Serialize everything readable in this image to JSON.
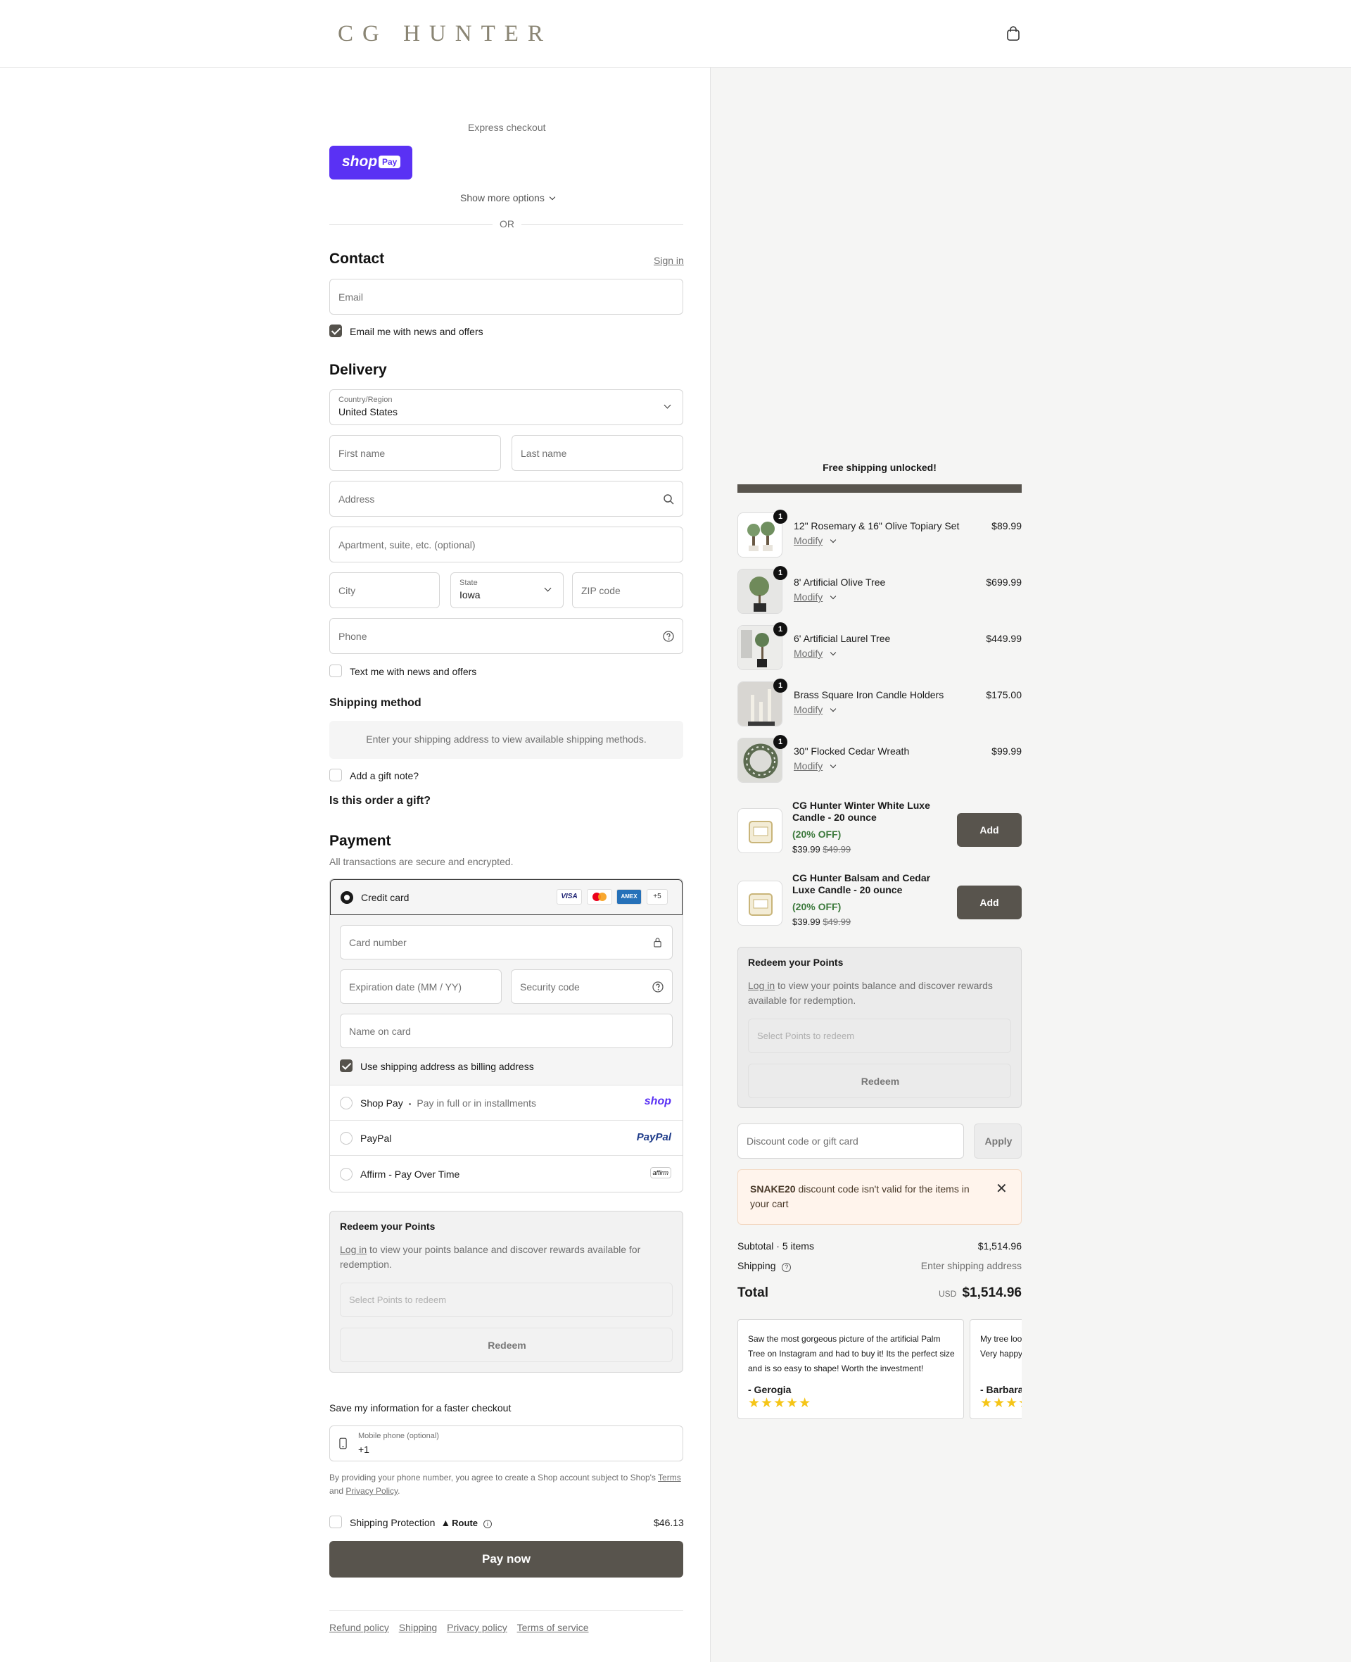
{
  "brand": {
    "logo_text": "CG HUNTER"
  },
  "express": {
    "title": "Express checkout",
    "shop_pay_label": "shop",
    "shop_pay_badge": "Pay",
    "show_more": "Show more options",
    "or": "OR"
  },
  "contact": {
    "title": "Contact",
    "sign_in": "Sign in",
    "email_placeholder": "Email",
    "email_news_label": "Email me with news and offers",
    "email_news_checked": true
  },
  "delivery": {
    "title": "Delivery",
    "country_label": "Country/Region",
    "country_value": "United States",
    "first_name": "First name",
    "last_name": "Last name",
    "address": "Address",
    "apartment": "Apartment, suite, etc. (optional)",
    "city": "City",
    "state_label": "State",
    "state_value": "Iowa",
    "zip": "ZIP code",
    "phone": "Phone",
    "text_news_label": "Text me with news and offers",
    "text_news_checked": false
  },
  "shipping_method": {
    "title": "Shipping method",
    "message": "Enter your shipping address to view available shipping methods."
  },
  "gift": {
    "gift_note_label": "Add a gift note?",
    "question": "Is this order a gift?"
  },
  "payment": {
    "title": "Payment",
    "subtitle": "All transactions are secure and encrypted.",
    "credit_card_label": "Credit card",
    "card_logos": [
      "VISA",
      "MC",
      "AMEX"
    ],
    "more_cards": "+5",
    "card_number": "Card number",
    "expiration": "Expiration date (MM / YY)",
    "security_code": "Security code",
    "name_on_card": "Name on card",
    "billing_same_label": "Use shipping address as billing address",
    "billing_same_checked": true,
    "shop_pay_label": "Shop Pay",
    "shop_pay_sep": "•",
    "shop_pay_desc": "Pay in full or in installments",
    "shop_pay_logo": "shop",
    "paypal_label": "PayPal",
    "paypal_logo": "PayPal",
    "affirm_label": "Affirm - Pay Over Time",
    "affirm_logo": "affirm"
  },
  "redeem_left": {
    "title": "Redeem your Points",
    "login": "Log in",
    "desc": " to view your points balance and discover rewards available for redemption.",
    "select_placeholder": "Select Points to redeem",
    "button": "Redeem"
  },
  "save_info": {
    "title": "Save my information for a faster checkout",
    "mobile_label": "Mobile phone (optional)",
    "mobile_value": "+1",
    "disclaimer_1": "By providing your phone number, you agree to create a Shop account subject to Shop's ",
    "terms": "Terms",
    "disclaimer_2": " and ",
    "privacy": "Privacy Policy",
    "disclaimer_3": "."
  },
  "protection": {
    "label": "Shipping Protection",
    "route_logo": "Route",
    "price": "$46.13"
  },
  "pay_now": "Pay now",
  "footer_links": [
    "Refund policy",
    "Shipping",
    "Privacy policy",
    "Terms of service"
  ],
  "summary": {
    "free_shipping": "Free shipping unlocked!",
    "free_shipping_progress": 1.0,
    "modify": "Modify",
    "items": [
      {
        "name": "12\" Rosemary & 16\" Olive Topiary Set",
        "price": "$89.99",
        "qty": "1"
      },
      {
        "name": "8' Artificial Olive Tree",
        "price": "$699.99",
        "qty": "1"
      },
      {
        "name": "6' Artificial Laurel Tree",
        "price": "$449.99",
        "qty": "1"
      },
      {
        "name": "Brass Square Iron Candle Holders",
        "price": "$175.00",
        "qty": "1"
      },
      {
        "name": "30\" Flocked Cedar Wreath",
        "price": "$99.99",
        "qty": "1"
      }
    ],
    "upsells": [
      {
        "name": "CG Hunter Winter White Luxe Candle - 20 ounce",
        "discount": "(20% OFF)",
        "price": "$39.99",
        "old_price": "$49.99",
        "button": "Add"
      },
      {
        "name": "CG Hunter Balsam and Cedar Luxe Candle - 20 ounce",
        "discount": "(20% OFF)",
        "price": "$39.99",
        "old_price": "$49.99",
        "button": "Add"
      }
    ],
    "redeem": {
      "title": "Redeem your Points",
      "login": "Log in",
      "desc": " to view your points balance and discover rewards available for redemption.",
      "select_placeholder": "Select Points to redeem",
      "button": "Redeem"
    },
    "discount_placeholder": "Discount code or gift card",
    "apply": "Apply",
    "error_code": "SNAKE20",
    "error_msg": " discount code isn't valid for the items in your cart",
    "subtotal_label": "Subtotal · 5 items",
    "subtotal_value": "$1,514.96",
    "shipping_label": "Shipping",
    "shipping_value": "Enter shipping address",
    "total_label": "Total",
    "currency": "USD",
    "total_value": "$1,514.96"
  },
  "reviews": [
    {
      "text": "Saw the most gorgeous picture of the artificial Palm Tree on Instagram and had to buy it! Its the perfect size and is so easy to shape! Worth the investment!",
      "author": "- Gerogia",
      "stars": "★★★★★"
    },
    {
      "text": "My tree looks so real and everyone comments on it! Very happy with purchase.",
      "author": "- Barbara",
      "stars": "★★★★★"
    }
  ],
  "colors": {
    "accent": "#58544d",
    "shop_purple": "#5a31f4",
    "discount_green": "#3d7a3d",
    "error_bg": "#fff4ec"
  }
}
